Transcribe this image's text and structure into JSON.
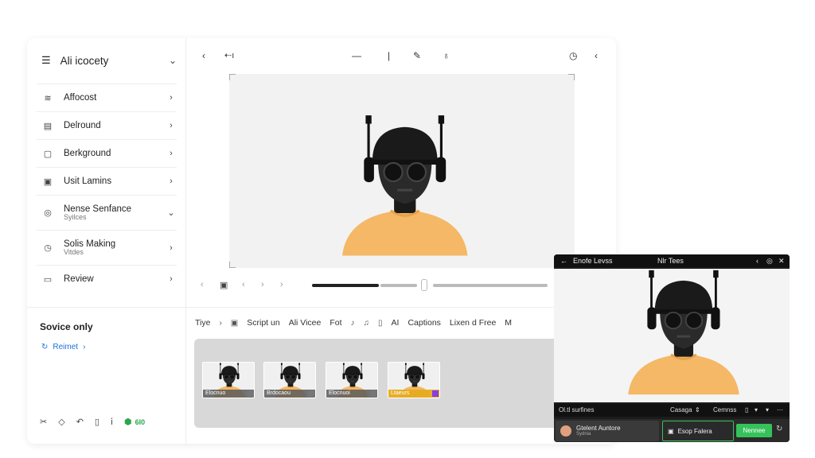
{
  "sidebar": {
    "title": "Ali icocety",
    "items": [
      {
        "label": "Affocost",
        "sub": "",
        "icon": "wave-icon"
      },
      {
        "label": "Delround",
        "sub": "",
        "icon": "document-icon"
      },
      {
        "label": "Berkground",
        "sub": "",
        "icon": "square-icon"
      },
      {
        "label": "Usit Lamins",
        "sub": "",
        "icon": "grid-icon"
      },
      {
        "label": "Nense Senfance",
        "sub": "Syilces",
        "icon": "globe-icon"
      },
      {
        "label": "Solis Making",
        "sub": "Vitdes",
        "icon": "clock-icon"
      },
      {
        "label": "Review",
        "sub": "",
        "icon": "image-icon"
      }
    ],
    "service_title": "Sovice only",
    "service_link": "Reimet",
    "footer_badge": "6I0"
  },
  "toolbar": {
    "undo_label": "⇠ı"
  },
  "tabs": [
    "Tiye",
    "Script un",
    "Ali Vicee",
    "Fot",
    "AI",
    "Captions",
    "Lixen d Free",
    "M"
  ],
  "thumbnails": [
    {
      "label": "Elocnuo",
      "accent": "#777777"
    },
    {
      "label": "Brdocaou",
      "accent": "#777777"
    },
    {
      "label": "Elocnuoi",
      "accent": "#777777"
    },
    {
      "label": "Ltaeurs",
      "accent": "#8a3ce0"
    }
  ],
  "preview": {
    "title": "Enofe Levss",
    "subtitle": "Nlr Tees",
    "bar_left": "Ol.tl surfines",
    "bar_mid": "Casaga",
    "bar_right": "Cemnss",
    "user_name": "Gtelent Auntore",
    "user_sub": "Sydnia",
    "select_label": "Esop Falera",
    "action_label": "Nennee"
  },
  "colors": {
    "accent_green": "#36c25a",
    "link_blue": "#1e6fd9",
    "shirt": "#f4b866"
  }
}
